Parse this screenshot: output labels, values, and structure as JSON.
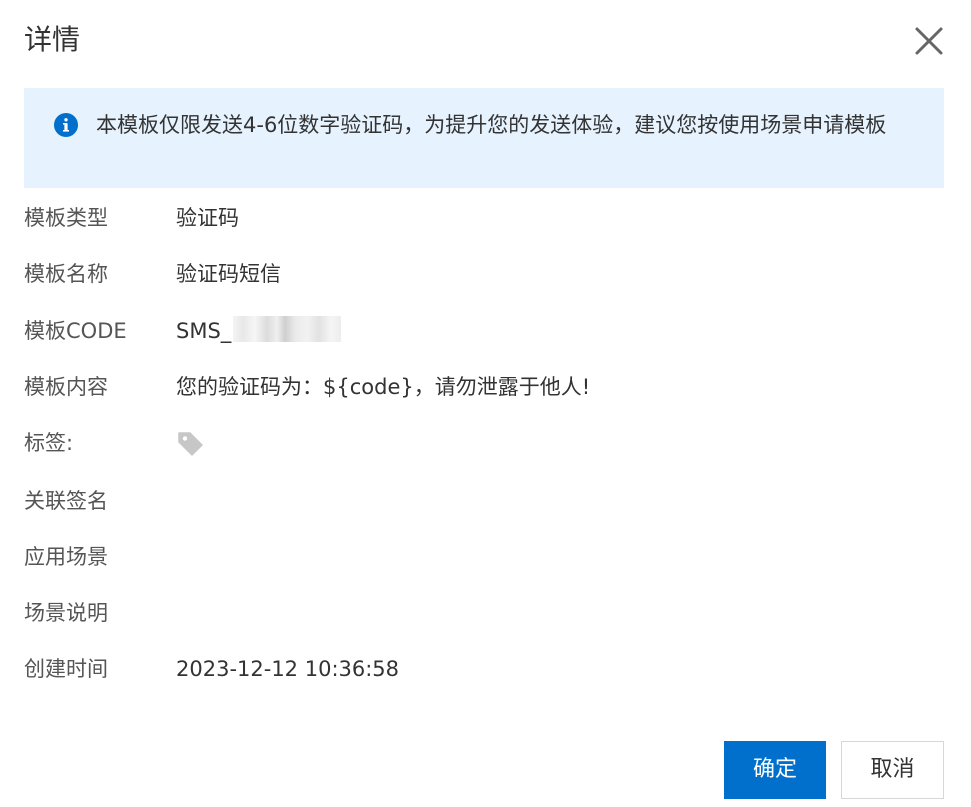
{
  "dialog": {
    "title": "详情"
  },
  "alert": {
    "icon": "info-icon",
    "text": "本模板仅限发送4-6位数字验证码，为提升您的发送体验，建议您按使用场景申请模板"
  },
  "fields": {
    "template_type": {
      "label": "模板类型",
      "value": "验证码"
    },
    "template_name": {
      "label": "模板名称",
      "value": "验证码短信"
    },
    "template_code": {
      "label": "模板CODE",
      "value": "SMS_"
    },
    "template_content": {
      "label": "模板内容",
      "value": "您的验证码为：${code}，请勿泄露于他人!"
    },
    "tags": {
      "label": "标签:",
      "icon": "tag-icon"
    },
    "linked_signature": {
      "label": "关联签名",
      "value": ""
    },
    "scenario": {
      "label": "应用场景",
      "value": ""
    },
    "scenario_desc": {
      "label": "场景说明",
      "value": ""
    },
    "created_time": {
      "label": "创建时间",
      "value": "2023-12-12 10:36:58"
    }
  },
  "buttons": {
    "ok_label": "确定",
    "cancel_label": "取消"
  },
  "colors": {
    "primary": "#0070cc",
    "alert_bg": "#e6f2fd",
    "info_icon": "#0070cc",
    "tag_icon": "#c7c7c7"
  }
}
